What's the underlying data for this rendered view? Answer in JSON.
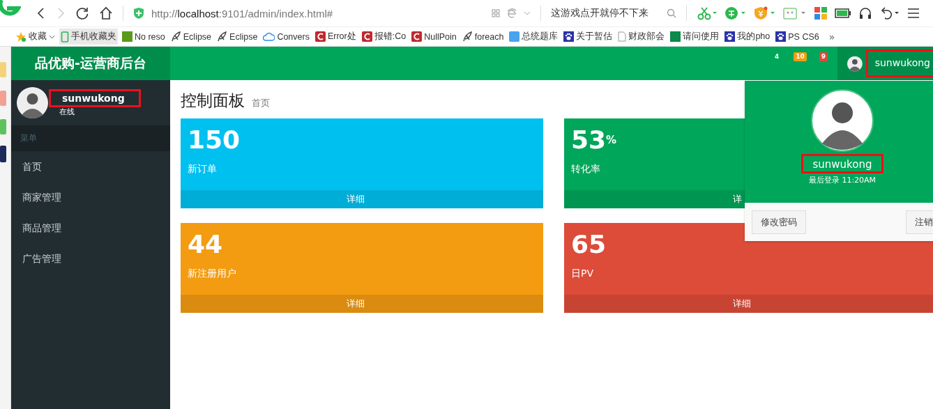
{
  "browser": {
    "url_host": "localhost",
    "url_prefix": "http://",
    "url_rest": ":9101/admin/index.html#",
    "search": "这游戏点开就停不下来",
    "bookmarks": [
      {
        "label": "收藏",
        "kind": "star"
      },
      {
        "label": "手机收藏夹",
        "kind": "phone"
      },
      {
        "label": "No reso",
        "kind": "tile"
      },
      {
        "label": "Eclipse",
        "kind": "feather"
      },
      {
        "label": "Eclipse",
        "kind": "feather"
      },
      {
        "label": "Convers",
        "kind": "cloud"
      },
      {
        "label": "Error处",
        "kind": "c-logo"
      },
      {
        "label": "报错:Co",
        "kind": "c-logo"
      },
      {
        "label": "NullPoin",
        "kind": "c-logo"
      },
      {
        "label": "foreach",
        "kind": "feather"
      },
      {
        "label": "总统题库",
        "kind": "blue-tile"
      },
      {
        "label": "关于暂估",
        "kind": "paw"
      },
      {
        "label": "财政部会",
        "kind": "page"
      },
      {
        "label": "请问使用",
        "kind": "sf"
      },
      {
        "label": "我的pho",
        "kind": "paw"
      },
      {
        "label": "PS CS6",
        "kind": "paw"
      }
    ],
    "more": "»"
  },
  "app": {
    "logo": "品优购-运营商后台",
    "notifications": [
      {
        "count": "4",
        "color": "#00a65a"
      },
      {
        "count": "10",
        "color": "#f39c12"
      },
      {
        "count": "9",
        "color": "#dd4b39"
      }
    ],
    "user_menu": {
      "name": "sunwukong",
      "highlighted": true
    },
    "sidebar": {
      "user": {
        "name": "sunwukong",
        "highlighted": true,
        "status": "在线"
      },
      "header": "菜单",
      "items": [
        {
          "label": "首页"
        },
        {
          "label": "商家管理"
        },
        {
          "label": "商品管理"
        },
        {
          "label": "广告管理"
        }
      ]
    },
    "page": {
      "title": "控制面板",
      "subtitle": "首页"
    },
    "stats": [
      {
        "value": "150",
        "label": "新订单",
        "footer": "详细",
        "color": "#00c0ef"
      },
      {
        "value": "53",
        "unit": "%",
        "label": "转化率",
        "footer": "详",
        "color": "#00a65a"
      },
      {
        "value": "44",
        "label": "新注册用户",
        "footer": "详细",
        "color": "#f39c12"
      },
      {
        "value": "65",
        "label": "日PV",
        "footer": "详细",
        "color": "#dd4b39"
      }
    ],
    "popup": {
      "name": "sunwukong",
      "highlighted": true,
      "last_login": "最后登录 11:20AM",
      "buttons": [
        "修改密码",
        "注销"
      ]
    }
  }
}
